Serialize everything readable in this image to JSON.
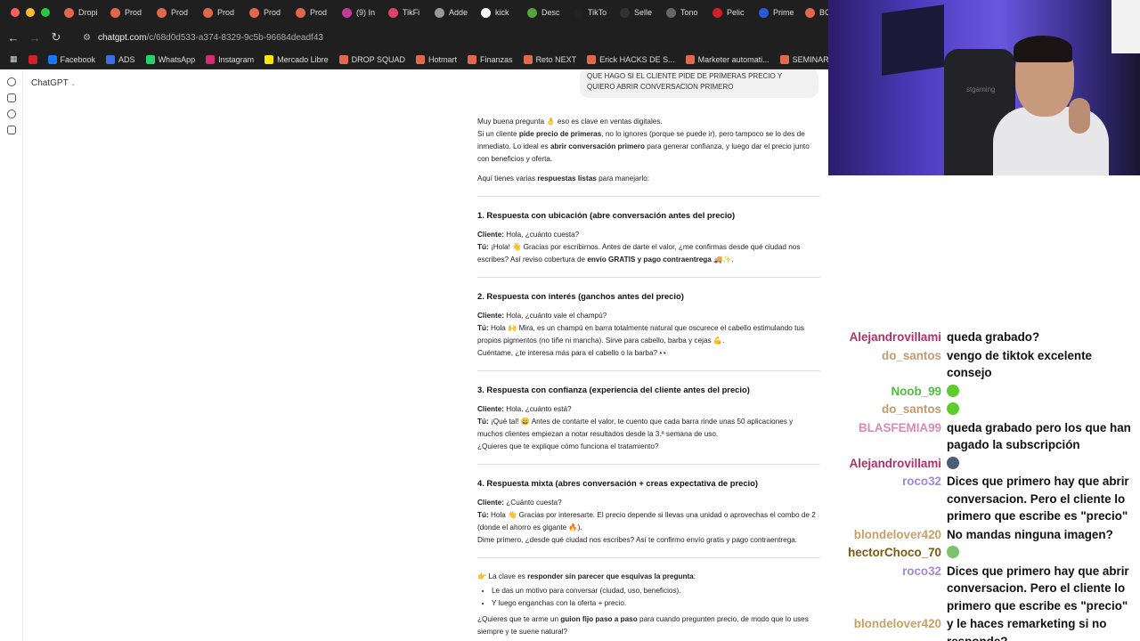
{
  "browser": {
    "tabs": [
      {
        "label": "Dropi",
        "color": "#e0684b"
      },
      {
        "label": "Prod",
        "color": "#e0684b"
      },
      {
        "label": "Prod",
        "color": "#e0684b"
      },
      {
        "label": "Prod",
        "color": "#e0684b"
      },
      {
        "label": "Prod",
        "color": "#e0684b"
      },
      {
        "label": "Prod",
        "color": "#e0684b"
      },
      {
        "label": "(9) In",
        "color": "#c23a9b"
      },
      {
        "label": "TikFi",
        "color": "#e0436a"
      },
      {
        "label": "Adde",
        "color": "#999999"
      },
      {
        "label": "kick",
        "color": "#ffffff"
      },
      {
        "label": "Desc",
        "color": "#5aa33c"
      },
      {
        "label": "TikTo",
        "color": "#222222"
      },
      {
        "label": "Selle",
        "color": "#333333"
      },
      {
        "label": "Tono",
        "color": "#666666"
      },
      {
        "label": "Pelic",
        "color": "#d0202a"
      },
      {
        "label": "Prime",
        "color": "#2a5bd7"
      },
      {
        "label": "BOF",
        "color": "#e0684b"
      }
    ],
    "url_host": "chatgpt.com",
    "url_path": "/c/68d0d533-a374-8329-9c5b-96684deadf43",
    "bookmarks": [
      {
        "label": "",
        "color": "#d0202a"
      },
      {
        "label": "Facebook",
        "color": "#1877f2"
      },
      {
        "label": "ADS",
        "color": "#3b6fe0"
      },
      {
        "label": "WhatsApp",
        "color": "#25d366"
      },
      {
        "label": "Instagram",
        "color": "#d62976"
      },
      {
        "label": "Mercado Libre",
        "color": "#ffe600"
      },
      {
        "label": "DROP SQUAD",
        "color": "#e0684b"
      },
      {
        "label": "Hotmart",
        "color": "#e0684b"
      },
      {
        "label": "Finanzas",
        "color": "#e0684b"
      },
      {
        "label": "Reto NEXT",
        "color": "#e0684b"
      },
      {
        "label": "Erick HACKS DE S...",
        "color": "#e0684b"
      },
      {
        "label": "Marketer automati...",
        "color": "#e0684b"
      },
      {
        "label": "SEMINARIOS ONLI...",
        "color": "#e0684b"
      }
    ]
  },
  "chatgpt": {
    "model_label": "ChatGPT",
    "user_message": "QUE HAGO SI EL CLIENTE PIDE DE PRIMERAS PRECIO Y QUIERO ABRIR CONVERSACION PRIMERO",
    "intro_1a": "Muy buena pregunta 👌 eso es clave en ventas digitales.",
    "intro_2a": "Si un cliente ",
    "intro_2b": "pide precio de primeras",
    "intro_2c": ", no lo ignores (porque se puede ir), pero tampoco se lo des de inmediato. Lo ideal es ",
    "intro_2d": "abrir conversación primero",
    "intro_2e": " para generar confianza, y luego dar el precio junto con beneficios y oferta.",
    "intro_3a": "Aquí tienes varias ",
    "intro_3b": "respuestas listas",
    "intro_3c": " para manejarlo:",
    "cliente": "Cliente:",
    "tu": "Tú:",
    "s1_title": "1. Respuesta con ubicación (abre conversación antes del precio)",
    "s1_cliente": " Hola, ¿cuánto cuesta?",
    "s1_tu_a": " ¡Hola! 👋 Gracias por escribirnos. Antes de darte el valor, ¿me confirmas desde qué ciudad nos escribes? Así reviso cobertura de ",
    "s1_tu_b": "envío GRATIS y pago contraentrega",
    "s1_tu_c": " 🚚✨.",
    "s2_title": "2. Respuesta con interés (ganchos antes del precio)",
    "s2_cliente": " Hola, ¿cuánto vale el champú?",
    "s2_tu": " Hola 🙌 Mira, es un champú en barra totalmente natural que oscurece el cabello estimulando tus propios pigmentos (no tiñe ni mancha). Sirve para cabello, barba y cejas 💪.",
    "s2_extra": "Cuéntame, ¿te interesa más para el cabello o la barba? 👀",
    "s3_title": "3. Respuesta con confianza (experiencia del cliente antes del precio)",
    "s3_cliente": " Hola, ¿cuánto está?",
    "s3_tu": " ¡Qué tal! 😀 Antes de contarte el valor, te cuento que cada barra rinde unas 50 aplicaciones y muchos clientes empiezan a notar resultados desde la 3.ª semana de uso.",
    "s3_extra": "¿Quieres que te explique cómo funciona el tratamiento?",
    "s4_title": "4. Respuesta mixta (abres conversación + creas expectativa de precio)",
    "s4_cliente": " ¿Cuánto cuesta?",
    "s4_tu": " Hola 👋 Gracias por interesarte. El precio depende si llevas una unidad o aprovechas el combo de 2 (donde el ahorro es gigante 🔥).",
    "s4_extra": "Dime primero, ¿desde qué ciudad nos escribes? Así te confirmo envío gratis y pago contraentrega.",
    "key_a": "👉 La clave es ",
    "key_b": "responder sin parecer que esquivas la pregunta",
    "key_c": ":",
    "bullets": [
      "Le das un motivo para conversar (ciudad, uso, beneficios).",
      "Y luego enganchas con la oferta + precio."
    ],
    "final_a": "¿Quieres que te arme un ",
    "final_b": "guion fijo paso a paso",
    "final_c": " para cuando pregunten precio, de modo que lo uses siempre y te suene natural?"
  },
  "webcam": {
    "chair_brand": "stgaming"
  },
  "chat": {
    "messages": [
      {
        "user": "Alejandrovillami",
        "color": "#b0306a",
        "text": "queda grabado?"
      },
      {
        "user": "do_santos",
        "color": "#c49a6c",
        "text": "vengo de tiktok excelente consejo"
      },
      {
        "user": "Noob_99",
        "color": "#4dbf3c",
        "text": "",
        "emoji": "#5ccd2d"
      },
      {
        "user": "do_santos",
        "color": "#c49a6c",
        "text": "",
        "emoji": "#5ccd2d"
      },
      {
        "user": "BLASFEMIA99",
        "color": "#d88ab5",
        "text": "queda grabado pero los que han pagado la subscripción"
      },
      {
        "user": "Alejandrovillami",
        "color": "#b0306a",
        "text": "",
        "emoji": "#4a5d7a"
      },
      {
        "user": "roco32",
        "color": "#9f8ad6",
        "text": "Dices que primero hay que abrir conversacion. Pero el cliente lo primero que escribe es \"precio\""
      },
      {
        "user": "blondelover420",
        "color": "#c7a06a",
        "text": "No mandas ninguna imagen?"
      },
      {
        "user": "hectorChoco_70",
        "color": "#7a5a14",
        "text": "",
        "emoji": "#7ac36a"
      },
      {
        "user": "roco32",
        "color": "#9f8ad6",
        "text": "Dices que primero hay que abrir conversacion. Pero el cliente lo primero que escribe es \"precio\""
      },
      {
        "user": "blondelover420",
        "color": "#c7a06a",
        "text": "y le haces remarketing si no responde?"
      }
    ]
  }
}
